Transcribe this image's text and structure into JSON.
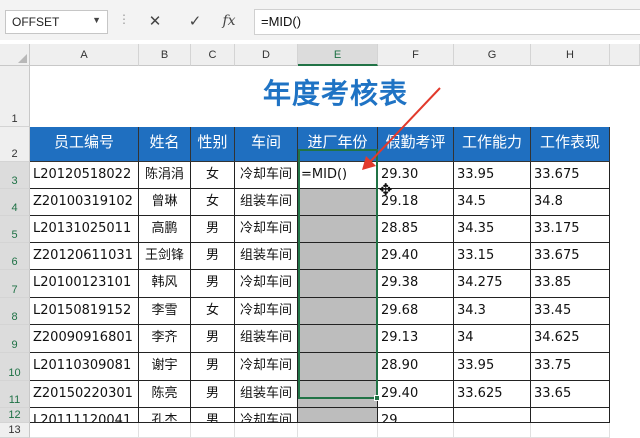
{
  "formula_bar": {
    "name_box": "OFFSET",
    "cancel_icon": "✕",
    "enter_icon": "✓",
    "fx_icon": "fx",
    "formula": "=MID()"
  },
  "columns": [
    "A",
    "B",
    "C",
    "D",
    "E",
    "F",
    "G",
    "H"
  ],
  "rows": [
    "1",
    "2",
    "3",
    "4",
    "5",
    "6",
    "7",
    "8",
    "9",
    "10",
    "11",
    "12",
    "13"
  ],
  "title": "年度考核表",
  "headers": [
    "员工编号",
    "姓名",
    "性别",
    "车间",
    "进厂年份",
    "假勤考评",
    "工作能力",
    "工作表现"
  ],
  "records": [
    {
      "id": "L20120518022",
      "name": "陈涓涓",
      "gender": "女",
      "workshop": "冷却车间",
      "year": "=MID()",
      "attendance": "29.30",
      "ability": "33.95",
      "performance": "33.675"
    },
    {
      "id": "Z20100319102",
      "name": "曾琳",
      "gender": "女",
      "workshop": "组装车间",
      "year": "",
      "attendance": "29.18",
      "ability": "34.5",
      "performance": "34.8"
    },
    {
      "id": "L20131025011",
      "name": "高鹏",
      "gender": "男",
      "workshop": "冷却车间",
      "year": "",
      "attendance": "28.85",
      "ability": "34.35",
      "performance": "33.175"
    },
    {
      "id": "Z20120611031",
      "name": "王剑锋",
      "gender": "男",
      "workshop": "组装车间",
      "year": "",
      "attendance": "29.40",
      "ability": "33.15",
      "performance": "33.675"
    },
    {
      "id": "L20100123101",
      "name": "韩风",
      "gender": "男",
      "workshop": "冷却车间",
      "year": "",
      "attendance": "29.38",
      "ability": "34.275",
      "performance": "33.85"
    },
    {
      "id": "L20150819152",
      "name": "李雪",
      "gender": "女",
      "workshop": "冷却车间",
      "year": "",
      "attendance": "29.68",
      "ability": "34.3",
      "performance": "33.45"
    },
    {
      "id": "Z20090916801",
      "name": "李齐",
      "gender": "男",
      "workshop": "组装车间",
      "year": "",
      "attendance": "29.13",
      "ability": "34",
      "performance": "34.625"
    },
    {
      "id": "L20110309081",
      "name": "谢宇",
      "gender": "男",
      "workshop": "冷却车间",
      "year": "",
      "attendance": "28.90",
      "ability": "33.95",
      "performance": "33.75"
    },
    {
      "id": "Z20150220301",
      "name": "陈亮",
      "gender": "男",
      "workshop": "组装车间",
      "year": "",
      "attendance": "29.40",
      "ability": "33.625",
      "performance": "33.65"
    },
    {
      "id": "L20111120041",
      "name": "孔杰",
      "gender": "男",
      "workshop": "冷却车间",
      "year": "",
      "attendance": "29.",
      "ability": "",
      "performance": ""
    }
  ],
  "colors": {
    "header_fill": "#1f6fc0",
    "title": "#1f73c4",
    "selection": "#217346",
    "arrow": "#e23a2c",
    "selected_range_fill": "#bdbdbd"
  }
}
